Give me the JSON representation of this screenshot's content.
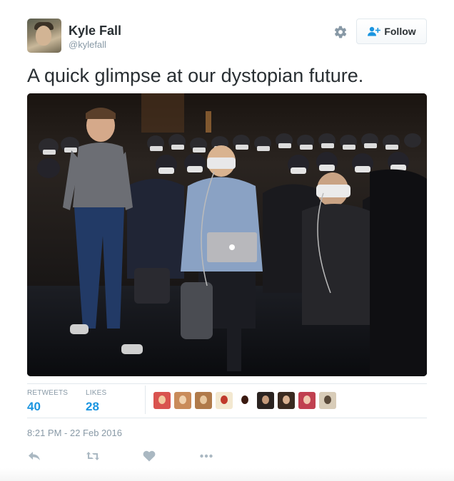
{
  "user": {
    "name": "Kyle Fall",
    "handle": "@kylefall",
    "avatar_icon": "user-avatar"
  },
  "header": {
    "settings_icon": "gear-icon",
    "follow_label": "Follow",
    "follow_icon": "add-user-icon"
  },
  "tweet": {
    "text": "A quick glimpse at our dystopian future.",
    "photo_icon": "photo-crowd-vr-headsets"
  },
  "stats": {
    "retweets_label": "RETWEETS",
    "retweets_count": "40",
    "likes_label": "LIKES",
    "likes_count": "28"
  },
  "likers": [
    {
      "icon": "liker-avatar",
      "bg": "#d9534f",
      "fg": "#f2c9a0"
    },
    {
      "icon": "liker-avatar",
      "bg": "#c98b5a",
      "fg": "#f0d2b0"
    },
    {
      "icon": "liker-avatar",
      "bg": "#b07a4a",
      "fg": "#e8c8a0"
    },
    {
      "icon": "liker-avatar",
      "bg": "#f3e8d0",
      "fg": "#c0392b"
    },
    {
      "icon": "liker-avatar",
      "bg": "#ffffff",
      "fg": "#3a1a10"
    },
    {
      "icon": "liker-avatar",
      "bg": "#2a2320",
      "fg": "#c49a7a"
    },
    {
      "icon": "liker-avatar",
      "bg": "#3a2a20",
      "fg": "#d8b090"
    },
    {
      "icon": "liker-avatar",
      "bg": "#c04050",
      "fg": "#f0c8b0"
    },
    {
      "icon": "liker-avatar",
      "bg": "#d8ccb8",
      "fg": "#5a4a3a"
    }
  ],
  "timestamp": "8:21 PM - 22 Feb 2016",
  "actions": {
    "reply_icon": "reply-icon",
    "retweet_icon": "retweet-icon",
    "like_icon": "heart-icon",
    "more_icon": "more-icon"
  },
  "colors": {
    "accent": "#1b95e0",
    "muted": "#8899a6",
    "text": "#292f33",
    "border": "#e1e8ed",
    "icon": "#aab8c2"
  }
}
